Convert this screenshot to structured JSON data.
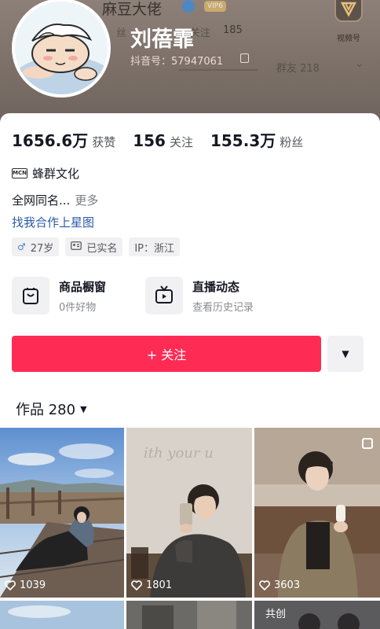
{
  "header": {
    "ghost_name": "麻豆大佬",
    "ghost_vip": "VIP6",
    "ghost_fans": "丝",
    "ghost_follow": "关注",
    "ghost_count": "185",
    "ghost_group": "群友 218",
    "channel_label": "视频号",
    "name": "刘蓓霏",
    "douyin_id": "抖音号：57947061"
  },
  "stats": [
    {
      "num": "1656.6万",
      "label": "获赞"
    },
    {
      "num": "156",
      "label": "关注"
    },
    {
      "num": "155.3万",
      "label": "粉丝"
    }
  ],
  "mcn": {
    "badge": "MCN",
    "name": "蜂群文化"
  },
  "bio": {
    "text": "全网同名...",
    "more": "更多"
  },
  "star_link": "找我合作上星图",
  "tags": {
    "age": "27岁",
    "realname": "已实名",
    "ip": "IP：浙江"
  },
  "features": {
    "shop_title": "商品橱窗",
    "shop_sub": "0件好物",
    "live_title": "直播动态",
    "live_sub": "查看历史记录"
  },
  "follow_label": "+ 关注",
  "works_label": "作品 280",
  "posts": [
    {
      "likes": "1039"
    },
    {
      "likes": "1801"
    },
    {
      "likes": "3603"
    }
  ],
  "cocreate_label": "共创",
  "colors": {
    "accent": "#fe2c55",
    "link": "#2b59a8",
    "header": "#7b6f68"
  }
}
